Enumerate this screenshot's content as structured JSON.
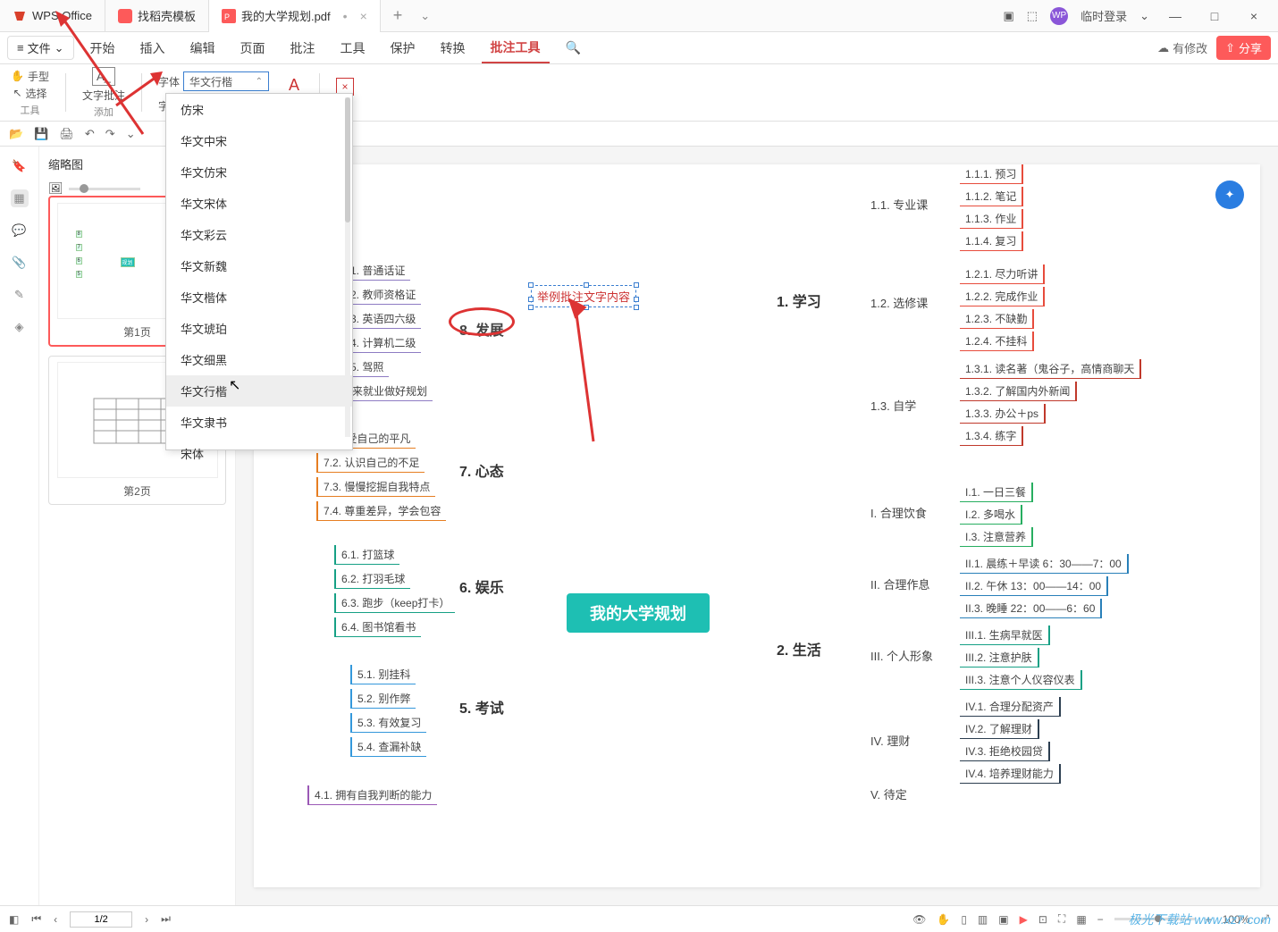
{
  "tabs": {
    "t0": "WPS Office",
    "t1": "找稻壳模板",
    "t2": "我的大学规划.pdf"
  },
  "win": {
    "login": "临时登录"
  },
  "menu": {
    "file": "文件",
    "m0": "开始",
    "m1": "插入",
    "m2": "编辑",
    "m3": "页面",
    "m4": "批注",
    "m5": "工具",
    "m6": "保护",
    "m7": "转换",
    "m8": "批注工具",
    "cloud": "有修改",
    "share": "分享"
  },
  "tool": {
    "hand": "手型",
    "select": "选择",
    "toolgrp": "工具",
    "textannot": "文字批注",
    "add": "添加",
    "font_lbl": "字体",
    "size_lbl": "字号",
    "font_val": "华文行楷"
  },
  "fonts": [
    "仿宋",
    "华文中宋",
    "华文仿宋",
    "华文宋体",
    "华文彩云",
    "华文新魏",
    "华文楷体",
    "华文琥珀",
    "华文细黑",
    "华文行楷",
    "华文隶书",
    "宋体"
  ],
  "thumbs": {
    "title": "缩略图",
    "p1": "第1页",
    "p2": "第2页"
  },
  "status": {
    "page": "1/2",
    "zoom": "100%"
  },
  "mm": {
    "center": "我的大学规划",
    "t8": "8. 发展",
    "t7": "7. 心态",
    "t6": "6. 娱乐",
    "t5": "5. 考试",
    "t4_1": "4.1. 拥有自我判断的能力",
    "t1": "1. 学习",
    "t2": "2. 生活",
    "n8": [
      "8.1. 普通话证",
      "8.2. 教师资格证",
      "8.3. 英语四六级",
      "8.4. 计算机二级",
      "8.5. 驾照",
      "未来就业做好规划"
    ],
    "n7": [
      "1. 接受自己的平凡",
      "7.2. 认识自己的不足",
      "7.3. 慢慢挖掘自我特点",
      "7.4. 尊重差异，学会包容"
    ],
    "n6": [
      "6.1. 打篮球",
      "6.2. 打羽毛球",
      "6.3. 跑步（keep打卡）",
      "6.4. 图书馆看书"
    ],
    "n5": [
      "5.1. 别挂科",
      "5.2. 别作弊",
      "5.3. 有效复习",
      "5.4. 查漏补缺"
    ],
    "g1": {
      "a": "1.1. 专业课",
      "b": "1.2. 选修课",
      "c": "1.3. 自学"
    },
    "g1a": [
      "1.1.1. 预习",
      "1.1.2. 笔记",
      "1.1.3. 作业",
      "1.1.4. 复习"
    ],
    "g1b": [
      "1.2.1. 尽力听讲",
      "1.2.2. 完成作业",
      "1.2.3. 不缺勤",
      "1.2.4. 不挂科"
    ],
    "g1c": [
      "1.3.1. 读名著（鬼谷子，高情商聊天",
      "1.3.2. 了解国内外新闻",
      "1.3.3. 办公＋ps",
      "1.3.4. 练字"
    ],
    "g2": {
      "a": "I. 合理饮食",
      "b": "II. 合理作息",
      "c": "III. 个人形象",
      "d": "IV. 理财",
      "e": "V. 待定"
    },
    "g2a": [
      "I.1. 一日三餐",
      "I.2. 多喝水",
      "I.3. 注意营养"
    ],
    "g2b": [
      "II.1. 晨练＋早读 6：30——7：00",
      "II.2. 午休 13：00——14：00",
      "II.3. 晚睡 22：00——6：60"
    ],
    "g2c": [
      "III.1. 生病早就医",
      "III.2. 注意护肤",
      "III.3. 注意个人仪容仪表"
    ],
    "g2d": [
      "IV.1. 合理分配资产",
      "IV.2. 了解理财",
      "IV.3. 拒绝校园贷",
      "IV.4. 培养理财能力"
    ]
  },
  "annot": "举例批注文字内容",
  "watermark": "极光下载站  www.xz7.com"
}
